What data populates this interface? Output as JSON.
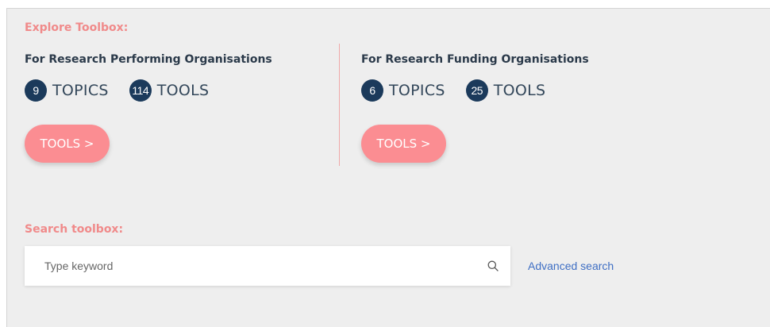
{
  "explore": {
    "title": "Explore Toolbox:",
    "rpo": {
      "heading": "For Research Performing Organisations",
      "topics_count": "9",
      "topics_label": "TOPICS",
      "tools_count": "114",
      "tools_label": "TOOLS",
      "button_label": "TOOLS >"
    },
    "rfo": {
      "heading": "For Research Funding Organisations",
      "topics_count": "6",
      "topics_label": "TOPICS",
      "tools_count": "25",
      "tools_label": "TOOLS",
      "button_label": "TOOLS >"
    }
  },
  "search": {
    "title": "Search toolbox:",
    "placeholder": "Type keyword",
    "value": "",
    "icon": "search-icon",
    "advanced_label": "Advanced search"
  },
  "colors": {
    "accent_pink": "#fb8d92",
    "title_pink": "#f08a8a",
    "badge_navy": "#1b3a5b",
    "link_blue": "#3f6fc4",
    "panel_bg": "#eeeeee"
  }
}
